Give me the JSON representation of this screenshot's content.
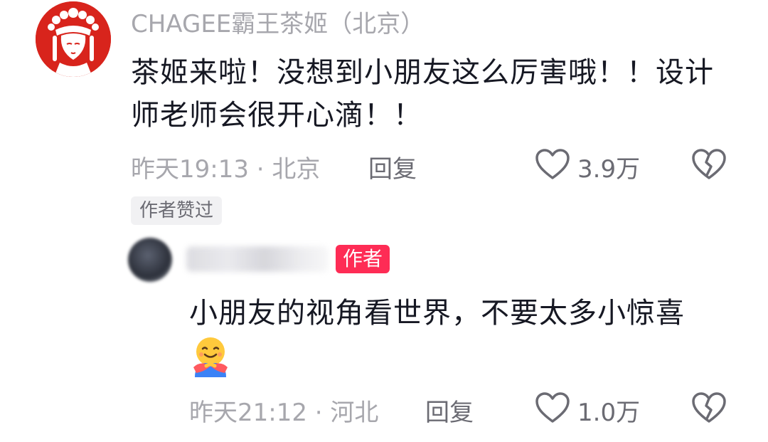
{
  "comment": {
    "username": "CHAGEE霸王茶姬（北京）",
    "text": "茶姬来啦！没想到小朋友这么厉害哦！！设计师老师会很开心滴！！",
    "meta": "昨天19:13 · 北京",
    "reply_label": "回复",
    "like_count": "3.9万",
    "liked_by_author_label": "作者赞过"
  },
  "reply": {
    "author_badge": "作者",
    "text": "小朋友的视角看世界，不要太多小惊喜",
    "emoji": "hugging-face-emoji",
    "meta": "昨天21:12 · 河北",
    "reply_label": "回复",
    "like_count": "1.0万"
  },
  "colors": {
    "accent": "#fe2c55",
    "muted": "#a7a7ad",
    "text": "#161823",
    "avatar_red": "#d8241c"
  }
}
